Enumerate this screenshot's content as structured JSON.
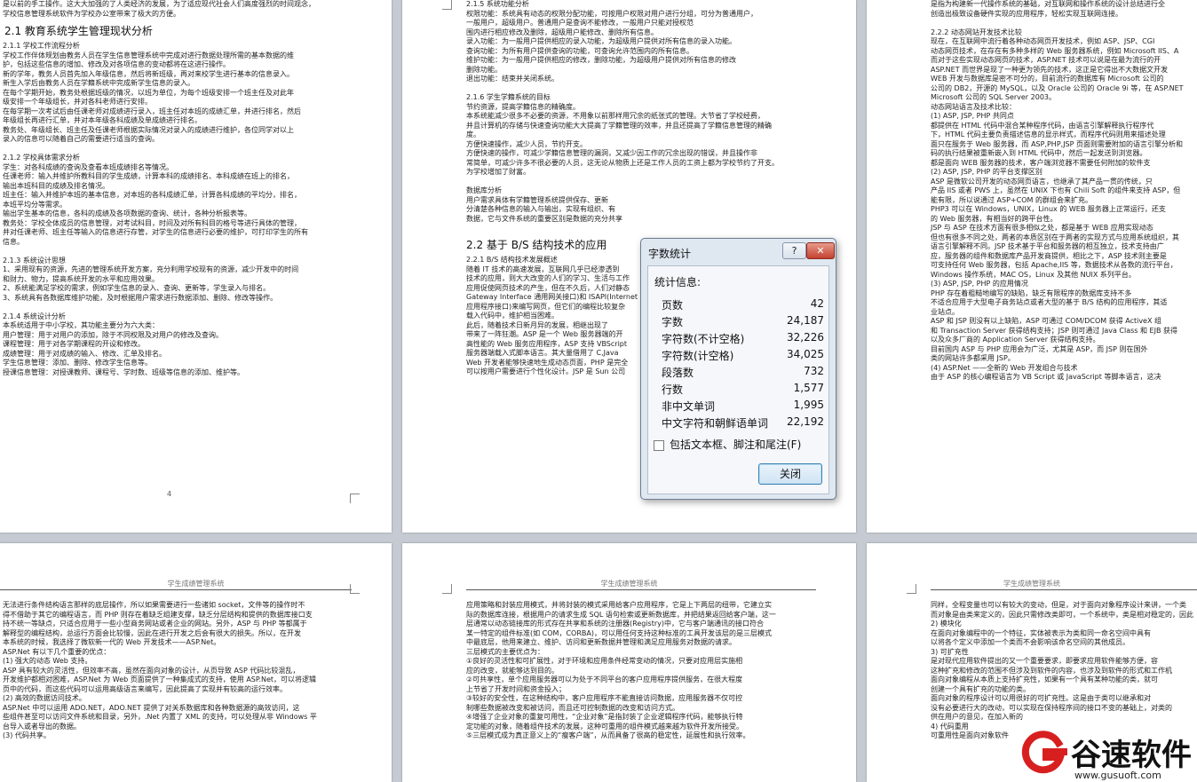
{
  "window": {
    "background": "#c6cbd3"
  },
  "pages": {
    "p1": {
      "lines_top": [
        "是以前的手工操作。这大大加强的了人类经济的发展，为了适应现代社会人们高度强烈的时间观念，",
        "学校信息管理系统软件为学校办公室带来了极大的方便。"
      ],
      "heading": "2.1  教育系统学生管理现状分析",
      "lines": [
        "2.1.1  学校工作流程分析",
        "    学校工作伴体规划由教务人员在学生信息管理系统中完成对进行数据处理所需的基本数据的维",
        "护，包括这些信息的增加、修改及对各项信息的变动都将在这进行操作。",
        "    新的学年，教务人员首先加入年级信息，然后将新班级，再对来校学生进行基本的信息录入。",
        "新生入学后由教务人员在学籍系统中完成新学生信息的录入。",
        "    在每个学期开始，教务处根据班级的情况，以班为单位，为每个班级安排一个班主任及对此年",
        "级安排一个年级组长，并对各科老师进行安排。",
        "    在每学期一次考试后由任课老师对成绩进行录入，班主任对本班的成绩汇单，并进行排名，然后",
        "年级组长再进行汇单，并对本年级各科成绩及单成绩进行排名。",
        "    教务处、年级组长、班主任及任课老师根据实际情况对录入的成绩进行维护，各位同学对以上",
        "录入的信息可以随着自己的需要进行适当的查询。",
        "",
        "2.1.2  学校具体需求分析",
        "    学生：对各科成绩的查询及查看本班成绩排名等情况。",
        "    任课老师：输入并维护所教科目的学生成绩，计算本科的成绩排名、本科成绩在班上的排名，",
        "输出本班科目的成绩及排名情况。",
        "    班主任：输入并维护本班的基本信息，对本班的各科成绩汇单，计算各科成绩的平均分，排名，",
        "本班平均分等需求。",
        "    输出学生基本的信息，各科的成绩及各项数据的查询、统计，各种分析报表等。",
        "    教务处：学校全体成员的信息管理，对考试科目，时间及对所有科目的格号等进行具体的管理，",
        "并对任课老师、班主任等输入的信息进行存管，对学生的信息进行必要的维护，可打印学生的所有",
        "信息。",
        "",
        "2.1.3  系统设计思想",
        "  1、采用现有的资源，先进的管理系统开发方案，充分利用学校现有的资源，减少开发中的时间",
        "     和财力、物力，提高系统开发的水平和应用效果。",
        "  2、系统能满足学校的需求，例如学生信息的录入、查询、更新等，学生录入与排名。",
        "  3、系统具有各数据库维护功能，及时根据用户需求进行数据添加、删除、修改等操作。",
        "",
        "2.1.4  系统设计分析",
        "    本系统适用于中小学校，其功能主要分为六大类：",
        "    用户管理：用于对用户的添加，除于不同权限及对用户的修改及查询。",
        "    课程管理：用于对各学期课程的开设和修改。",
        "    成绩管理：用于对成绩的输入、修改、汇单及排名。",
        "      学生信息管理：添加、删除、修改学生信息等。",
        "      授课信息管理：对授课教师、课程号、学时数、班级等信息的添加、维护等。"
      ],
      "page_number": "4"
    },
    "p2": {
      "lines": [
        "2.1.5  系统功能分析",
        "       权限功能：系统具有动态的权限分配功能，可按用户权限对用户进行分组，可分为普通用户，",
        "                一般用户，超级用户。普通用户是查询不能修改，一般用户只能对授权范",
        "                围内进行相应修改及删除，超级用户能修改、删除所有信息。",
        "       录入功能：为一般用户提供相应的录入功能，为超级用户提供对所有信息的录入功能。",
        "       查询功能：为所有用户提供查询的功能，可查询允许范围内的所有信息。",
        "       维护功能：为一般用户提供相应的修改，删除功能，为超级用户提供对所有信息的修改",
        "                删除功能。",
        "       退出功能：结束并关闭系统。",
        "",
        "2.1.6  学生学籍系统的目标",
        "节约资源，提高学籍信息的精确度。",
        "    本系统能减少很多不必要的资源，不用象以前那样用冗余的纸张式的管理。大节省了学校经费，",
        "并且计算机的存储与快速查询功能大大提高了学籍管理的效率，并且还提高了学籍信息管理的精确",
        "度。",
        "方便快速操作，减少人员，节约开支。",
        "    方便快速的操作，可减少学籍信息管理的漏洞，又减少因工作的冗余出现的错误，并且操作非",
        "常简单，可减少许多不很必要的人员，这无论从物质上还是工作人员的工资上都为学校节约了开支。",
        "为学校增加了财富。",
        "",
        "数据库分析",
        "    用户需求具体有学籍管理系统提供保存、更新",
        "分清楚各种信息的输入与输出，实现有组织、有",
        "数据，它与文件系统的重要区别是数据的充分共享"
      ],
      "heading": "2.2   基于 B/S 结构技术的应用",
      "lines2": [
        "2.2.1   B/S 结构技术发展概述",
        "    随着 IT 技术的高速发展，互联网几乎已经渗透到",
        "技术的应用，则大大改变的人们的学习、生活与工作",
        "应用促使网页技术的产生，但在不久后，人们对静态",
        "Gateway Interface 通用网关接口)和 ISAPI(Internet",
        "应用程序接口)来编写网页，但它们的编程比较复杂",
        "载入代码中，维护相当困难。",
        "    此后，随着技术日新月异的发展，相继出现了",
        "带来了一阵狂潮。ASP 是一个 Web 服务器端的开",
        "高性能的 Web 服务应用程序，ASP 支持 VBScript",
        "服务器端载入式脚本语言。其大量借用了 C,Java",
        "Web 开发者能够快速地生成动态页面，PHP 是完全",
        "可以按用户需要进行个性化设计。JSP 是 Sun 公司"
      ]
    },
    "p3": {
      "lines": [
        "是指为构建新一代操作系统的基础，对互联网和操作系统的设计总结进行全",
        "创造出极致设备硬件实现的应用程序，轻松实现互联网连接。",
        "",
        "2.2.2  动态网站开发技术比较",
        "    现在，在互联网中流行着各种动态网页开发技术，例如 ASP、JSP、CGI",
        "动态网页技术，在存在有多种多样的 Web 服务器系统，例如 Microsoft IIS、A",
        "而对于这些实现动态网页的技术，ASP.NET 技术可以说是在最为流行的开",
        "ASP.NET 而世界是现了一种更为领先的技术，这正是它得出不大数据文开发",
        "    WEB 开发与数据库是密不可分的，目前流行的数据库有 Microsoft 公司的",
        "公司的 DB2，开源的 MySQL，以及 Oracle 公司的 Oracle 9i 等，在 ASP.NET",
        "Microsoft 公司的 SQL Server 2003。",
        "动态网站语言及技术比较：",
        "(1) ASP, JSP, PHP 共同点",
        "    都提供在 HTML 代码中混合某种程序代码，由语言引擎解释执行程序代",
        "下，HTML 代码主要负责描述信息的显示样式，而程序代码则用来描述处理",
        "面只在服务于 Web 服务器，而 ASP,PHP,JSP 页面则需要附加的语言引擎分析和",
        "码的执行结果被重新嵌入到 HTML 代码中，然后一起发送到浏览器。",
        "    都是面向 WEB 服务器的技术，客户端浏览器不需要任何附加的软件支",
        "(2) ASP, JSP, PHP 的平台支撑区别",
        "    ASP 是微软公司开发的动态网页语言，也继承了其产品一贯的传统，只",
        "产品 IIS 或者 PWS 上，虽然在 UNIX 下也有 Chili Soft 的组件来支持 ASP，但",
        "能有限，所以说通过 ASP+COM 的群组会来扩充。",
        "    PHP3 可以在 Windows，UNIX，Linux 的 WEB 服务器上正常运行，还支",
        "的 Web 服务器，有相当好的跨平台性。",
        "    JSP 与 ASP 在技术方面有很多相似之处，都是基于 WEB 应用实现动态",
        "但也有很多不同之处，两者的本质区别在于两者的实现方式与应用系统组织，其",
        "语言引擎解释不同。JSP 技术基于平台和服务器的相互独立，技术支持由广",
        "应，服务器的组件和数据库产品开发商提供，相比之下，ASP 技术则主要是",
        "可支持任何 Web 服务器，包括 Apache,IIS 等，数据技术从各数的流行平台，",
        "Windows 操作系统，MAC OS，Linux 及其他 NUIX 系列平台。",
        "(3) ASP, JSP, PHP 的应用情况",
        "    PHP 存在着粗糙地编写的缺陷，缺乏有限程序的数据库支持不多",
        "不适合应用于大型电子商务站点或者大型的基于 B/S 结构的应用程序，其适",
        "业站点。",
        "    ASP 和 JSP 则没有以上缺陷，ASP 可通过 COM/DCOM 获得 ActiveX 组",
        "和 Transaction Server 获得结构支持；JSP 则可通过 Java Class 和 EJB 获得",
        "以及众多厂商的 Application Server 获得结构支持。",
        "    目前国内 ASP 与 PHP 应用会为广泛，尤其是 ASP，而 JSP 则在国外",
        "类的网站许多都采用 JSP。",
        "(4)  ASP.Net ——全新的 Web 开发组合与技术",
        "    由于 ASP 的核心编程语言为 VB Script 或 JavaScript 等脚本语言，这决"
      ]
    },
    "p4": {
      "header": "学生成绩管理系统",
      "lines": [
        "无法进行条件结构语言那样的底层操作，所以如果需要进行一些诸如 socket，文件等的操作时不",
        "得不借助于其它的编程语言，而 PHP 则存在着缺乏组建支撑，缺乏分层结构和提供的数据库接口支",
        "持不统一等缺点，只适合应用于一些小型商务网站或者企业的网站。另外，ASP 与 PHP 等都属于",
        "解释型的编程结构，总运行方面会比较慢，因此在进行开发之后会有很大的损失。所以，在开发",
        "本系统的时候，我选择了微软新一代的 Web 开发技术——ASP.Net。",
        "ASP.Net 有以下几个重要的优点：",
        "  (1)  强大的动态 Web 支持。",
        "    ASP 具有较大的灵活性，但效率不高，虽然在面向对象的设计，从页导致 ASP 代码比较混乱，",
        "开发维护都相对困难，ASP.Net 为 Web 页面提供了一种集成式的支持，使用 ASP.Net，可以将逻辑",
        "页中的代码，而这些代码可以运用高级语言来编写，因此提高了实现并有较高的运行效率。",
        "  (2)  高效的数据访问技术。",
        "    ASP.Net 中可以运用 ADO.NET，ADO.NET 提供了对关系数据库和各种数据源的高效访问，这",
        "些组件甚至可以访问文件系统和目录，另外，.Net 内置了 XML 的支持，可以处理从非 Windows 平",
        "台导入或者导出的数据。",
        "  (3)  代码共享。"
      ]
    },
    "p5": {
      "header": "学生成绩管理系统",
      "lines": [
        "应用策略和封装应用模式，并将封装的模式采用给客户应用程序，它是上下两层的纽带，它建立实",
        "际的数据库连接，根据用户的请求生成 SQL 语句检索或更新数据库，并把结果返回给客户端，这一",
        "层通常以动态链接库的形式存在共享和系统的注册器(Registry)中，它与客户端通讯的接口符合",
        "某一特定的组件标准(如 COM，CORBA)，可以用任何支持这种标准的工具开发该层的是三层模式",
        "中最底层，他用来建立、维护、访问和更新数据并管理和满足应用服务对数据的请求。",
        "三层模式的主要优点为：",
        "    ①良好的灵活性和可扩展性，对于环境和应用条件经常变动的情况，只要对应用层实施相",
        "应的改变，就能够达到目的。",
        "    ②可共享性，单个应用服务器可以为处于不同平台的客户应用程序提供服务，在很大程度",
        "上节省了开发时间和资金投入；",
        "    ③较好的安全性，在这种结构中，客户应用程序不能直接访问数据，应用服务器不仅可控",
        "制哪些数据被改变和被访问，而且还可控制数据的改变和访问方式。",
        "    ④增强了企业对象的重复可用性，“企业对象”是指封装了企业逻辑程序代码，能够执行特",
        "定功能的对象，随着组件技术的发展，这种可重用的组件模式越来越为软件开发所接受。",
        "    ⑤三层模式成为真正意义上的“瘦客户端”，从而具备了很高的稳定性，延展性和执行效率。"
      ]
    },
    "p6": {
      "header": "学生成绩管理系统",
      "lines": [
        "同样，全程变量也可以有较大的变动，但是，对于面向对象程序设计来讲，一个类",
        "而对象是由类来定义的，因此只需修改类即可，一个系统中，类是相对稳定的，因此",
        "  2)  模块化",
        "    在面向对象编程中的一个特征，实体被表示为类和同一命名空间中具有",
        "以将各个定义中添加一个类而不会影响该命名空间的其他成员。",
        "  3)  可扩充性",
        "    是对现代应用软件提出的又一个重要要求，即要求应用软件能够方便，容",
        "这种扩充和修改的范围不但涉及到软件的内容，也涉及到软件的形式和工作机",
        "    面向对象编程从本质上支持扩充性，如果有一个具有某种功能的类，就可",
        "创建一个具有扩充的功能的类。",
        "    面向对象的程序设计可以用很好的可扩充性。这是由于类可以继承和对",
        "没有必要进行大的改动，可以实现在保持程序间的接口不变的基础上，对类的",
        "供在用户的意见，在加入新的",
        "  4)  代码重用",
        "    可重用性是面向对象软件"
      ]
    }
  },
  "dialog": {
    "title": "字数统计",
    "help_label": "?",
    "close_icon_label": "✕",
    "section_title": "统计信息:",
    "rows": [
      {
        "label": "页数",
        "value": "42"
      },
      {
        "label": "字数",
        "value": "24,187"
      },
      {
        "label": "字符数(不计空格)",
        "value": "32,226"
      },
      {
        "label": "字符数(计空格)",
        "value": "34,025"
      },
      {
        "label": "段落数",
        "value": "732"
      },
      {
        "label": "行数",
        "value": "1,577"
      },
      {
        "label": "非中文单词",
        "value": "1,995"
      },
      {
        "label": "中文字符和朝鲜语单词",
        "value": "22,192"
      }
    ],
    "checkbox_label": "包括文本框、脚注和尾注(F)",
    "close_button_label": "关闭"
  },
  "logo": {
    "text": "谷速软件",
    "url": "www.gusuoft.com"
  }
}
